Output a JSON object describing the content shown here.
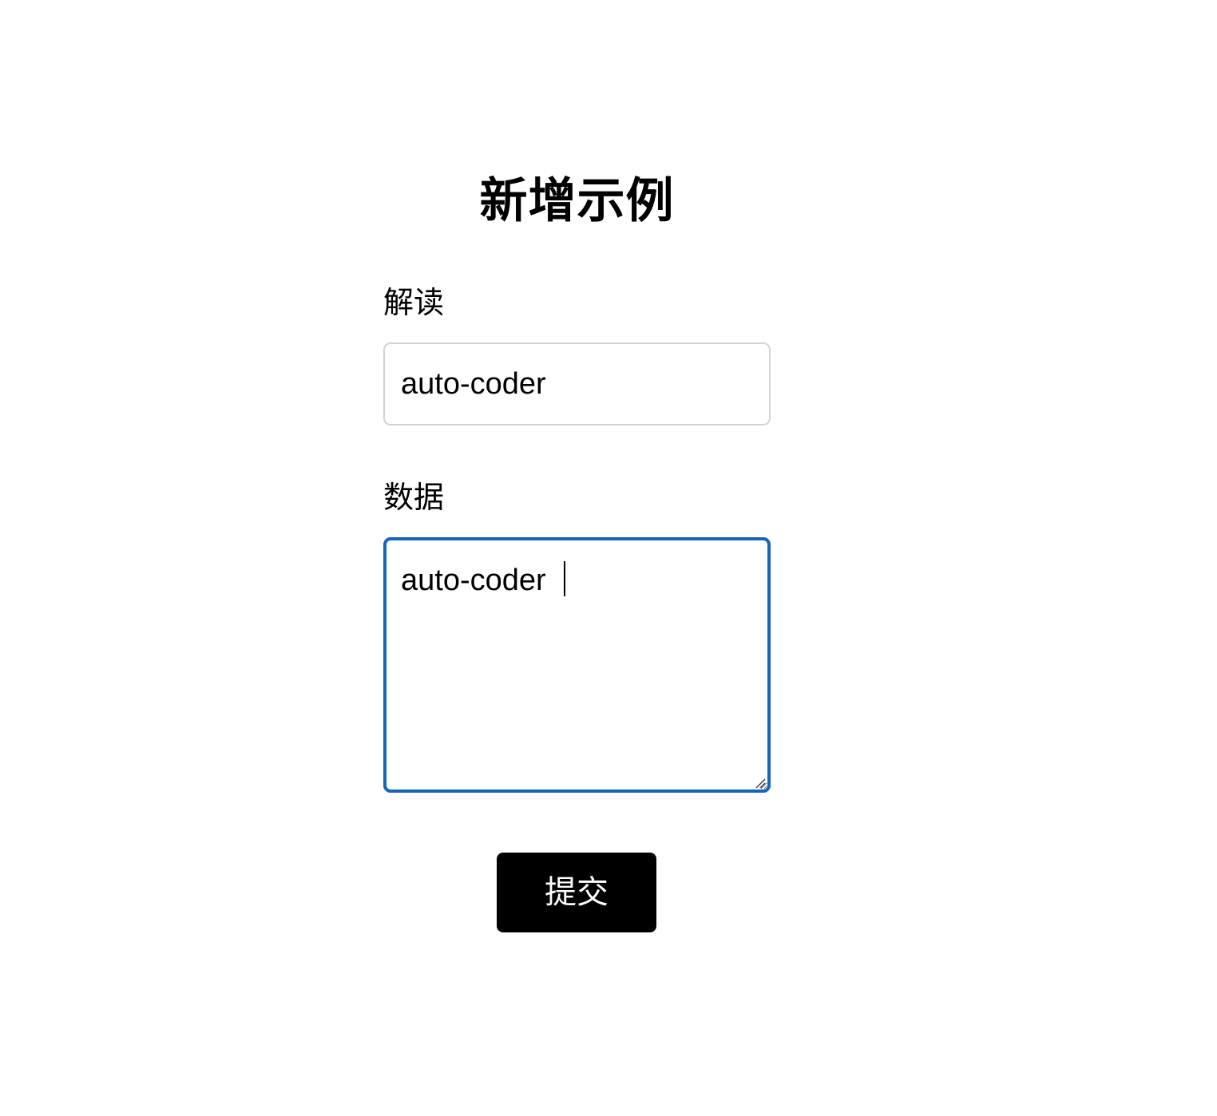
{
  "page": {
    "title": "新增示例"
  },
  "form": {
    "interpretation": {
      "label": "解读",
      "value": "auto-coder"
    },
    "data": {
      "label": "数据",
      "value": "auto-coder"
    },
    "submit_label": "提交"
  },
  "colors": {
    "focus_border": "#1565c0",
    "input_border": "#d4d4d8",
    "button_bg": "#000000",
    "button_text": "#ffffff"
  }
}
